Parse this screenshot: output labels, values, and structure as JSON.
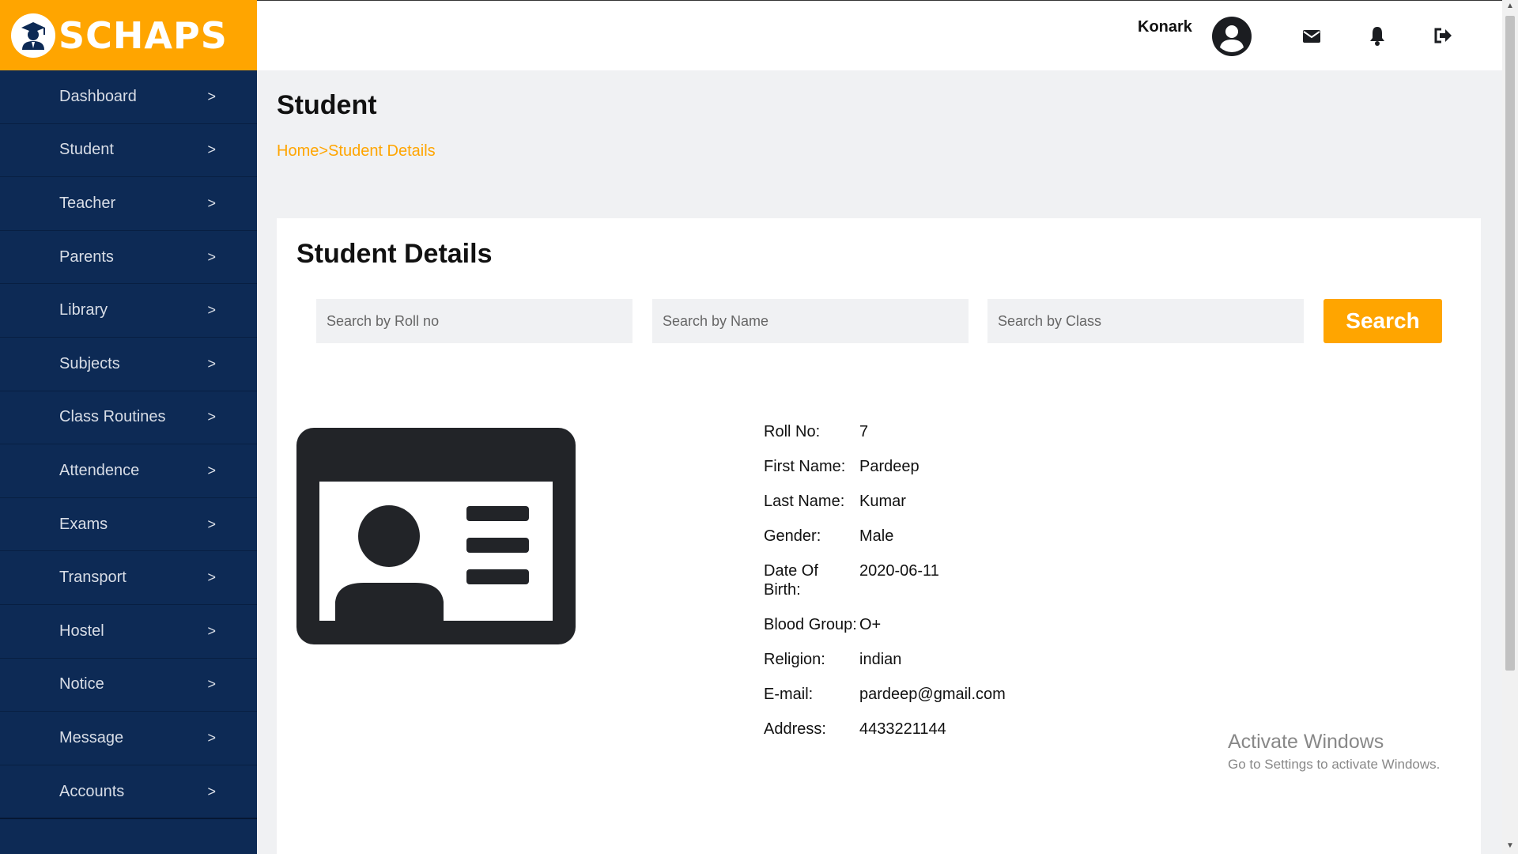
{
  "app": {
    "logo_text": "SCHAPS"
  },
  "sidebar": {
    "items": [
      {
        "label": "Dashboard",
        "chevron": ">"
      },
      {
        "label": "Student",
        "chevron": ">"
      },
      {
        "label": "Teacher",
        "chevron": ">"
      },
      {
        "label": "Parents",
        "chevron": ">"
      },
      {
        "label": "Library",
        "chevron": ">"
      },
      {
        "label": "Subjects",
        "chevron": ">"
      },
      {
        "label": "Class Routines",
        "chevron": ">"
      },
      {
        "label": "Attendence",
        "chevron": ">"
      },
      {
        "label": "Exams",
        "chevron": ">"
      },
      {
        "label": "Transport",
        "chevron": ">"
      },
      {
        "label": "Hostel",
        "chevron": ">"
      },
      {
        "label": "Notice",
        "chevron": ">"
      },
      {
        "label": "Message",
        "chevron": ">"
      },
      {
        "label": "Accounts",
        "chevron": ">"
      }
    ]
  },
  "header": {
    "user_name": "Konark",
    "icons": [
      "user-avatar-icon",
      "envelope-icon",
      "bell-icon",
      "sign-out-icon"
    ]
  },
  "page": {
    "title": "Student",
    "breadcrumb": {
      "home": "Home",
      "sep": ">",
      "current": "Student Details"
    }
  },
  "card": {
    "title": "Student Details",
    "search": {
      "roll_placeholder": "Search by Roll no",
      "name_placeholder": "Search by Name",
      "class_placeholder": "Search by Class",
      "button_label": "Search"
    },
    "details": [
      {
        "label": "Roll No:",
        "value": "7"
      },
      {
        "label": "First Name:",
        "value": "Pardeep"
      },
      {
        "label": "Last Name:",
        "value": "Kumar"
      },
      {
        "label": "Gender:",
        "value": "Male"
      },
      {
        "label": "Date Of Birth:",
        "value": "2020-06-11"
      },
      {
        "label": "Blood Group:",
        "value": "O+"
      },
      {
        "label": "Religion:",
        "value": "indian"
      },
      {
        "label": "E-mail:",
        "value": "pardeep@gmail.com"
      },
      {
        "label": "Address:",
        "value": "4433221144"
      }
    ]
  },
  "watermark": {
    "line1": "Activate Windows",
    "line2": "Go to Settings to activate Windows."
  },
  "colors": {
    "accent": "#ffa500",
    "sidebar": "#0d2a55",
    "background": "#f0f1f3"
  }
}
